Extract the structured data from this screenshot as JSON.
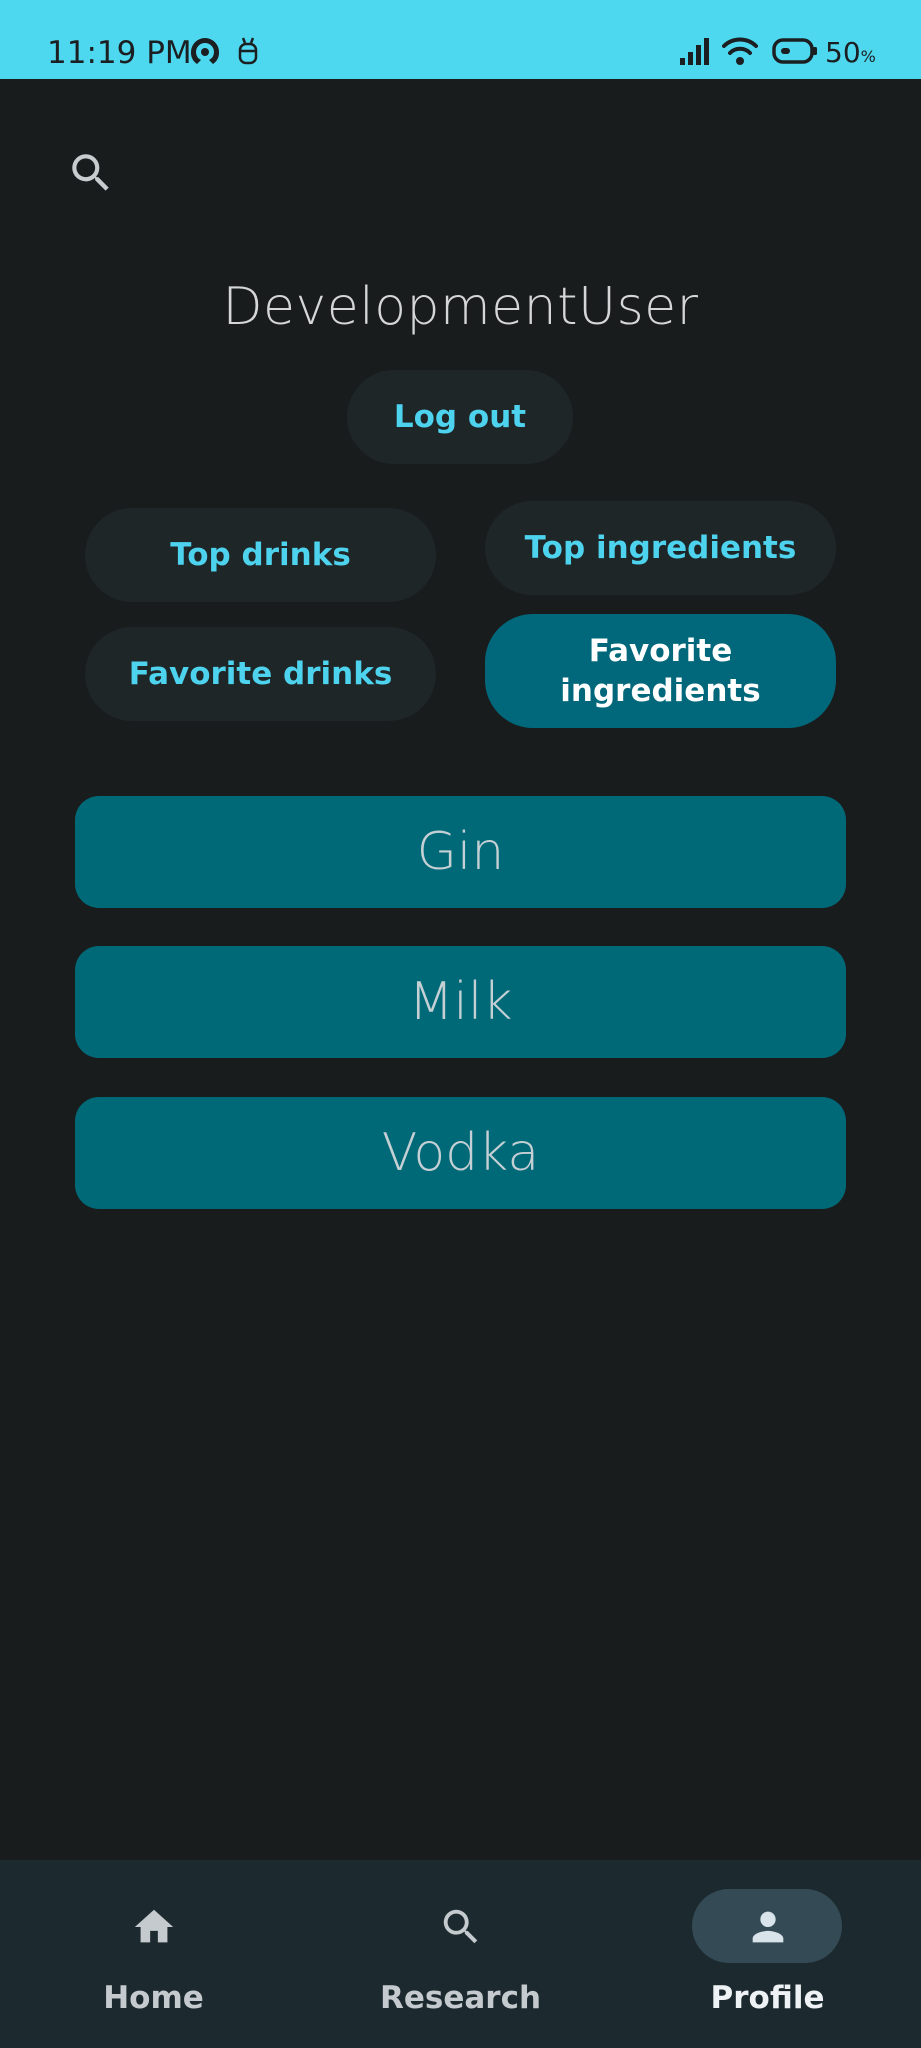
{
  "status_bar": {
    "time": "11:19 PM",
    "battery_level": "50",
    "battery_unit": "%",
    "icons": [
      "hotspot-icon",
      "debug-icon",
      "signal-icon",
      "wifi-icon",
      "battery-icon"
    ],
    "background_color": "#4dd8f0"
  },
  "header": {
    "search_icon": "search-icon"
  },
  "profile": {
    "username": "DevelopmentUser",
    "logout_label": "Log out"
  },
  "filters": {
    "top_drinks": "Top drinks",
    "top_ingredients": "Top ingredients",
    "favorite_drinks": "Favorite drinks",
    "favorite_ingredients_line1": "Favorite",
    "favorite_ingredients_line2": "ingredients",
    "selected": "Favorite ingredients"
  },
  "ingredients": [
    {
      "name": "Gin"
    },
    {
      "name": "Milk"
    },
    {
      "name": "Vodka"
    }
  ],
  "bottom_nav": {
    "items": [
      {
        "label": "Home",
        "icon": "home-icon"
      },
      {
        "label": "Research",
        "icon": "search-icon"
      },
      {
        "label": "Profile",
        "icon": "person-icon"
      }
    ],
    "active": "Profile"
  },
  "colors": {
    "background": "#191c1d",
    "accent": "#4dd3ee",
    "selected_fill": "#00687a",
    "pill_fill": "#1f2628",
    "nav_background": "#1c2a30"
  }
}
